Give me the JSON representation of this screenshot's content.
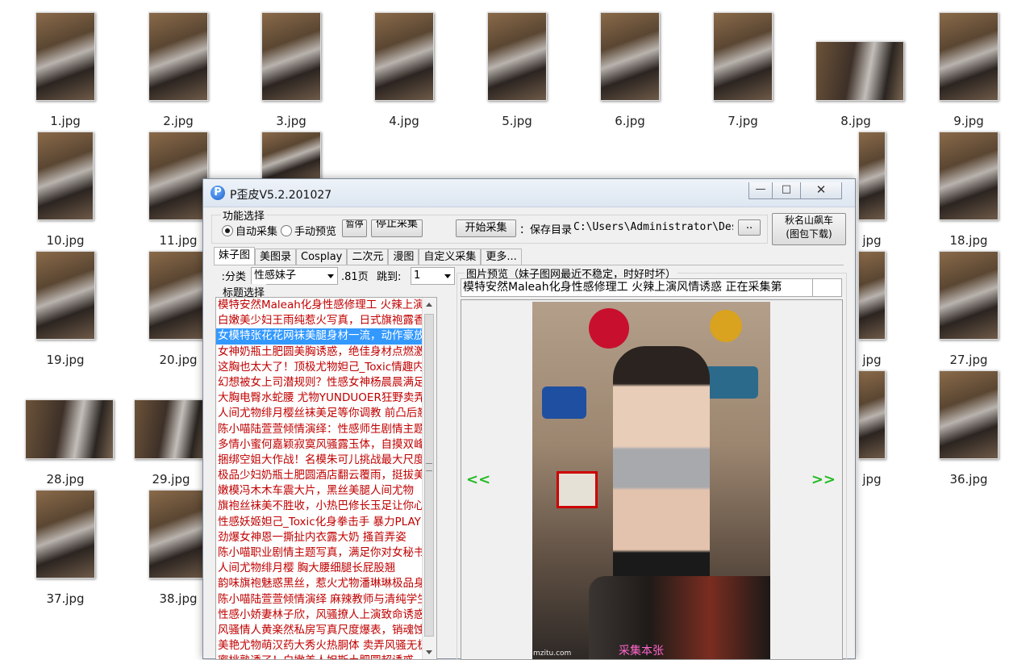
{
  "desktop": {
    "files": [
      {
        "name": "1.jpg"
      },
      {
        "name": "2.jpg"
      },
      {
        "name": "3.jpg"
      },
      {
        "name": "4.jpg"
      },
      {
        "name": "5.jpg"
      },
      {
        "name": "6.jpg"
      },
      {
        "name": "7.jpg"
      },
      {
        "name": "8.jpg"
      },
      {
        "name": "9.jpg"
      },
      {
        "name": "10.jpg"
      },
      {
        "name": "11.jpg"
      },
      {
        "name": "18.jpg"
      },
      {
        "name": "19.jpg"
      },
      {
        "name": "20.jpg"
      },
      {
        "name": "27.jpg"
      },
      {
        "name": "28.jpg"
      },
      {
        "name": "29.jpg"
      },
      {
        "name": "36.jpg"
      },
      {
        "name": "37.jpg"
      },
      {
        "name": "38.jpg"
      },
      {
        "name": "jpg"
      },
      {
        "name": "jpg"
      },
      {
        "name": "jpg"
      },
      {
        "name": "jpg"
      }
    ]
  },
  "window": {
    "title": "P歪皮V5.2.201027",
    "icon": "p-logo-icon",
    "controls": {
      "minimize": "—",
      "maximize": "□",
      "close": "✕"
    }
  },
  "function_group": {
    "legend": "功能选择",
    "radio_auto": "自动采集",
    "radio_manual": "手动预览",
    "btn_pause": "暂停",
    "btn_stop": "停止采集",
    "btn_start": "开始采集",
    "save_dir_label": "保存目录：",
    "save_dir_value": "C:\\Users\\Administrator\\Desktop",
    "browse": "..",
    "car_btn_line1": "秋名山飙车",
    "car_btn_line2": "(图包下载)"
  },
  "tabs": [
    "妹子图",
    "美图录",
    "Cosplay",
    "二次元",
    "漫图",
    "自定义采集",
    "更多..."
  ],
  "category": {
    "label": "分类:",
    "value": "性感妹子",
    "pages": ".81页",
    "jump_label": "跳到:",
    "jump_value": "1"
  },
  "title_list": {
    "legend": "标题选择",
    "items": [
      "模特安然Maleah化身性感修理工 火辣上演风情诱惑",
      "白嫩美少妇王雨纯惹火写真，日式旗袍露香肩",
      "女模特张花花网袜美腿身材一流，动作豪放",
      "女神奶瓶土肥圆美胸诱惑，绝佳身材点燃激情",
      "这胸也太大了！顶极尤物妲己_Toxic情趣内衣",
      "幻想被女上司潜规则？性感女神杨晨晨满足你",
      "大胸电臀水蛇腰 尤物YUNDUOER狂野卖弄风骚",
      "人间尤物绯月樱丝袜美足等你调教 前凸后翘",
      "陈小喵陆萱萱倾情演绎：性感师生剧情主题",
      "多情小蜜何嘉颖寂寞风骚露玉体，自摸双峰",
      "捆绑空姐大作战！名模朱可儿挑战最大尺度",
      "极品少妇奶瓶土肥圆酒店翻云覆雨，挺拔美乳",
      "嫩模冯木木车震大片，黑丝美腿人间尤物",
      "旗袍丝袜美不胜收，小热巴修长玉足让你心动",
      "性感妖姬妲己_Toxic化身拳击手 暴力PLAY",
      "劲爆女神恩一撕扯内衣露大奶 搔首弄姿",
      "陈小喵职业剧情主题写真，满足你对女秘书的幻想",
      "人间尤物绯月樱 胸大腰细腿长屁股翘",
      "韵味旗袍魅惑黑丝，惹火尤物潘琳琳极品身材",
      "陈小喵陆萱萱倾情演绎 麻辣教师与清纯学生",
      "性感小娇妻林子欣，风骚撩人上演致命诱惑",
      "风骚情人黄楽然私房写真尺度爆表，销魂蚀骨",
      "美艳尤物萌汉药大秀火热胴体 卖弄风骚无极限",
      "蜜桃熟透了！白嫩美人妲斯土肥圆超诱惑"
    ]
  },
  "preview": {
    "legend": "图片预览（妹子图网最近不稳定，时好时坏）",
    "current_title": "模特安然Maleah化身性感修理工 火辣上演风情诱惑 正在采集第",
    "prev": "<<",
    "next": ">>",
    "watermark": "mzitu.com",
    "status": "采集本张",
    "colors": {
      "nav": "#22bb22",
      "status": "#ff66cc",
      "list_text": "#c00000",
      "selection": "#3399ff"
    }
  }
}
